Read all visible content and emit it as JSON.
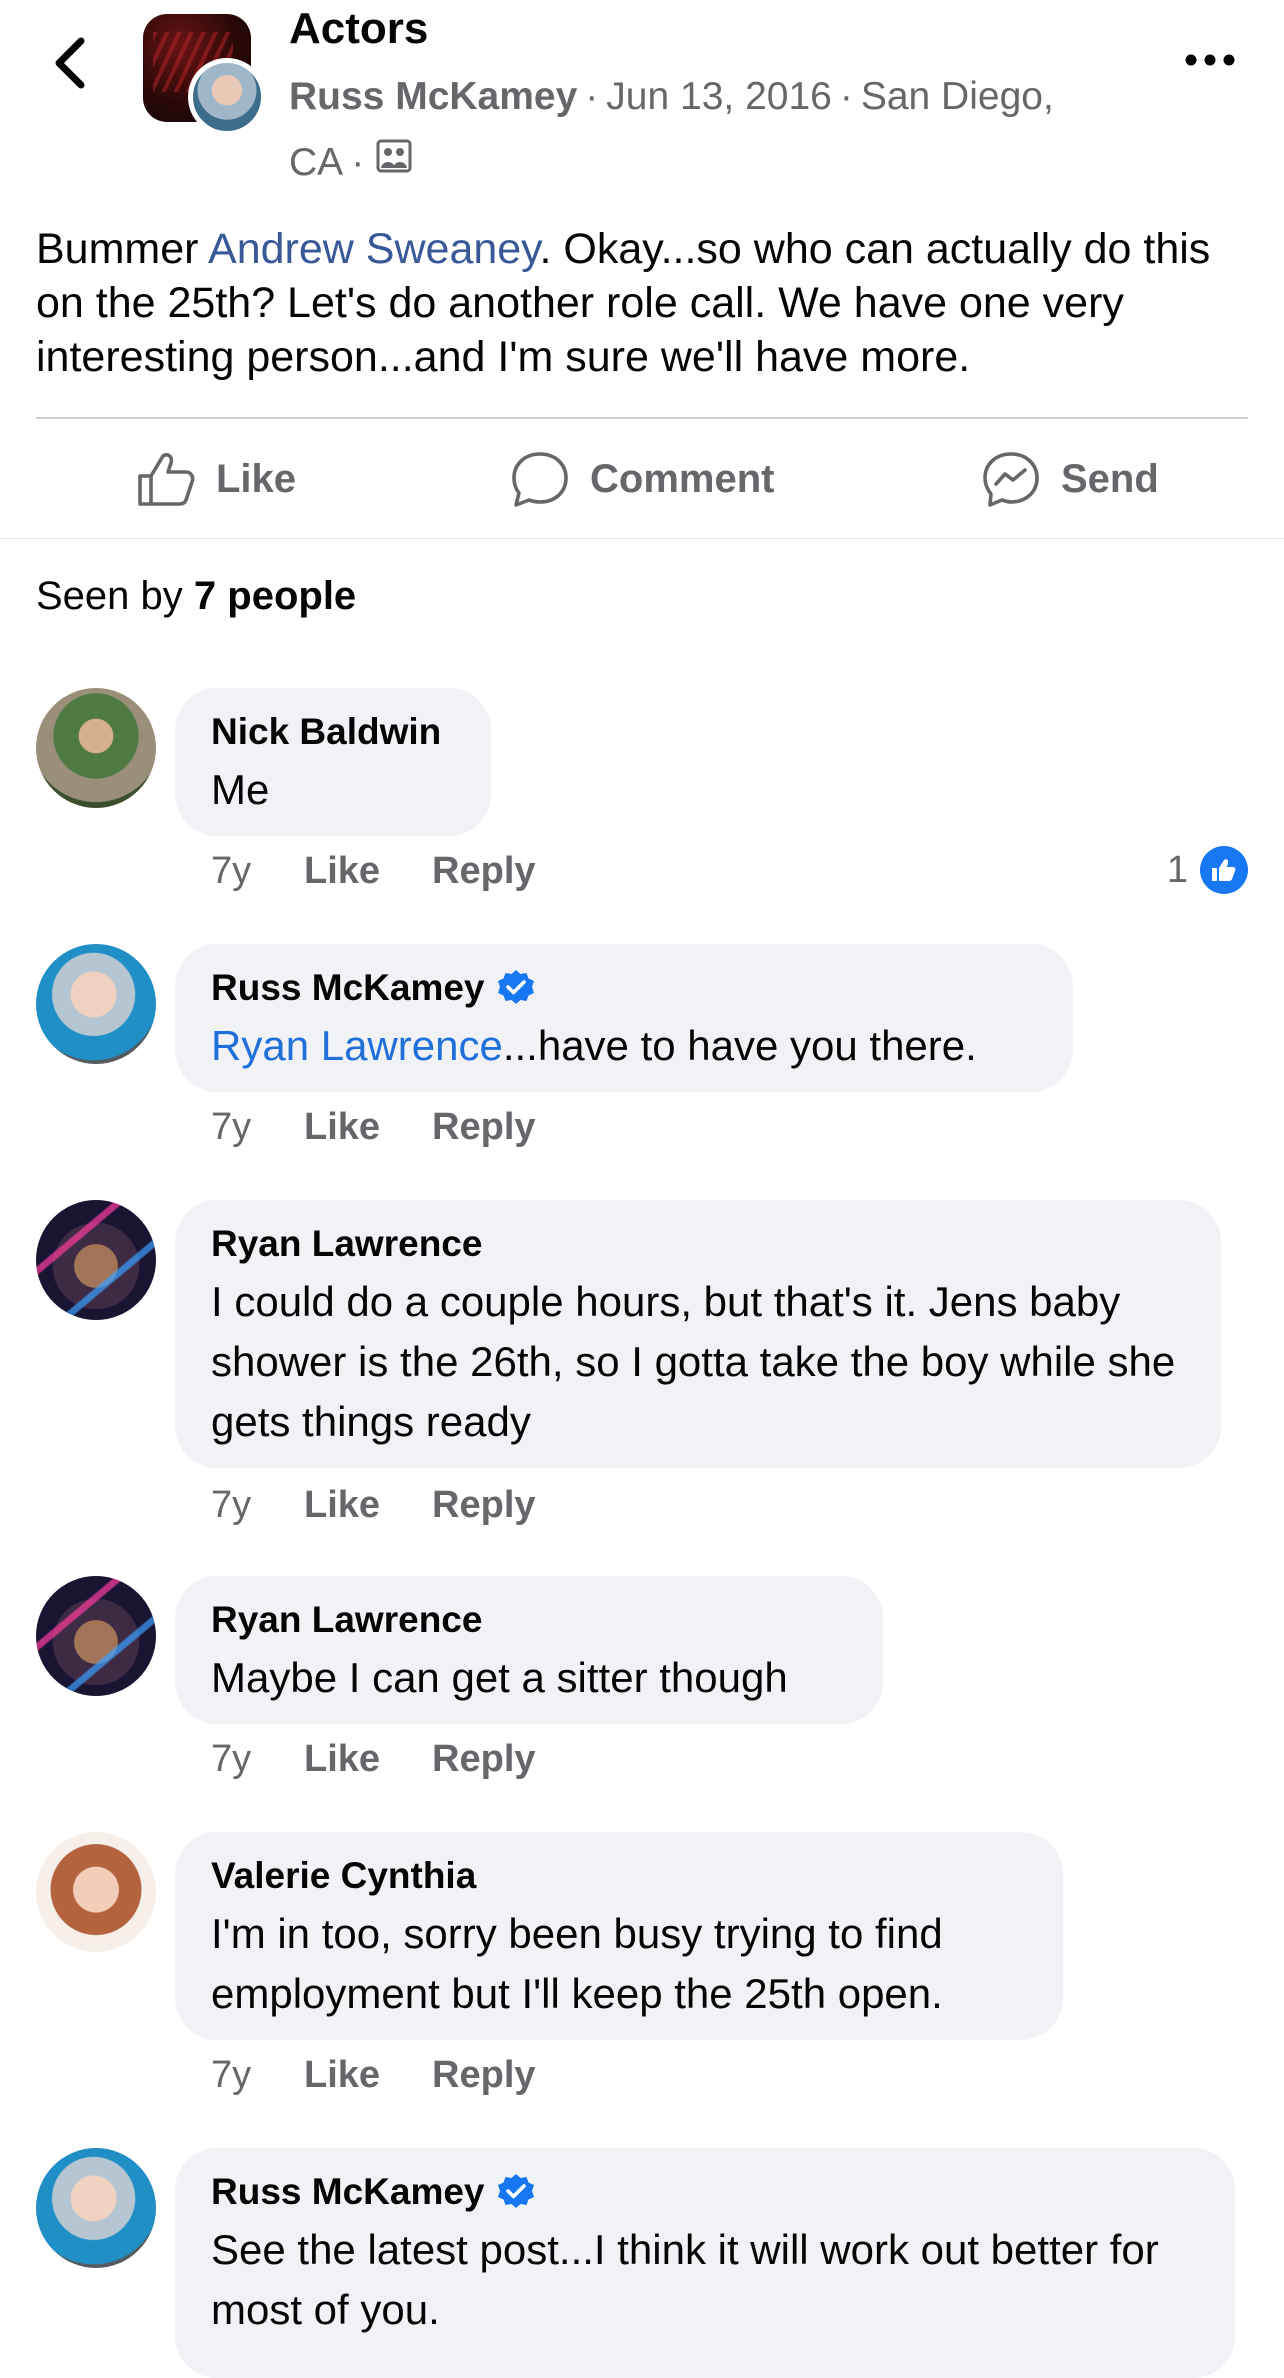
{
  "header": {
    "group_name": "Actors",
    "author": "Russ McKamey",
    "date": "Jun 13, 2016",
    "location_line1": "San Diego,",
    "location_line2": "CA",
    "dot": "·"
  },
  "post": {
    "text_prefix": "Bummer ",
    "mention": "Andrew Sweaney",
    "text_suffix": ". Okay...so who can actually do this on the 25th? Let's do another role call. We have one very interesting person...and I'm sure we'll have more."
  },
  "actions": {
    "like": "Like",
    "comment": "Comment",
    "send": "Send"
  },
  "seen_by": {
    "prefix": "Seen by",
    "count": "7 people"
  },
  "colors": {
    "accent": "#1877f2",
    "mention": "#385898",
    "bubble": "#f0f2f5",
    "meta": "#65676b"
  },
  "comments": [
    {
      "name": "Nick Baldwin",
      "text": "Me",
      "age": "7y",
      "like": "Like",
      "reply": "Reply",
      "reactions": "1"
    },
    {
      "name": "Russ McKamey",
      "verified": true,
      "mention": "Ryan Lawrence",
      "text": "...have to have you there.",
      "age": "7y",
      "like": "Like",
      "reply": "Reply"
    },
    {
      "name": "Ryan Lawrence",
      "text": "I could do a couple hours, but that's it. Jens baby shower is the 26th, so I gotta take the boy while she gets things ready",
      "age": "7y",
      "like": "Like",
      "reply": "Reply"
    },
    {
      "name": "Ryan Lawrence",
      "text": "Maybe I can get a sitter though",
      "age": "7y",
      "like": "Like",
      "reply": "Reply"
    },
    {
      "name": "Valerie Cynthia",
      "text": "I'm in too, sorry been busy trying to find employment but I'll keep the 25th open.",
      "age": "7y",
      "like": "Like",
      "reply": "Reply"
    },
    {
      "name": "Russ McKamey",
      "verified": true,
      "text": "See the latest post...I think it will work out better for most of you."
    }
  ]
}
